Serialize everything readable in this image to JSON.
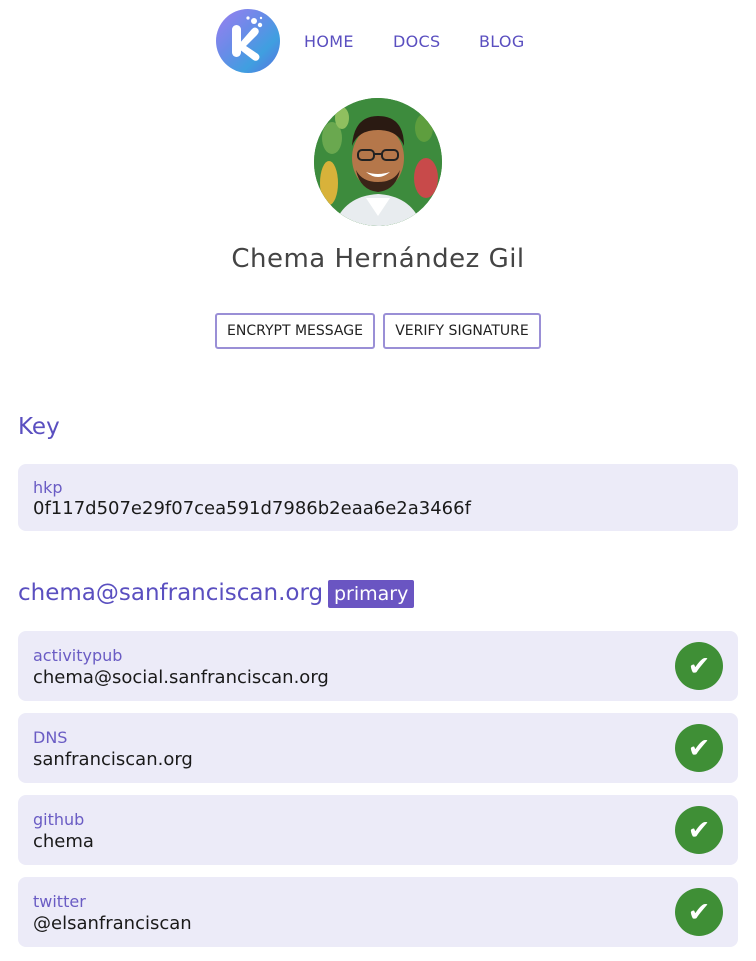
{
  "nav": {
    "links": [
      "HOME",
      "DOCS",
      "BLOG"
    ]
  },
  "profile": {
    "name": "Chema Hernández Gil"
  },
  "actions": {
    "encrypt": "ENCRYPT MESSAGE",
    "verify": "VERIFY SIGNATURE"
  },
  "key_section": {
    "title": "Key",
    "type": "hkp",
    "fingerprint": "0f117d507e29f07cea591d7986b2eaa6e2a3466f"
  },
  "identity": {
    "email": "chema@sanfranciscan.org",
    "badge": "primary",
    "proofs": [
      {
        "type": "activitypub",
        "value": "chema@social.sanfranciscan.org",
        "status": "✔"
      },
      {
        "type": "DNS",
        "value": "sanfranciscan.org",
        "status": "✔"
      },
      {
        "type": "github",
        "value": "chema",
        "status": "✔"
      },
      {
        "type": "twitter",
        "value": "@elsanfranciscan",
        "status": "✔"
      }
    ]
  },
  "colors": {
    "accent": "#5a4fc0",
    "badge": "#6a55c2",
    "verified": "#3f8f36",
    "card_bg": "#ecebf8"
  }
}
